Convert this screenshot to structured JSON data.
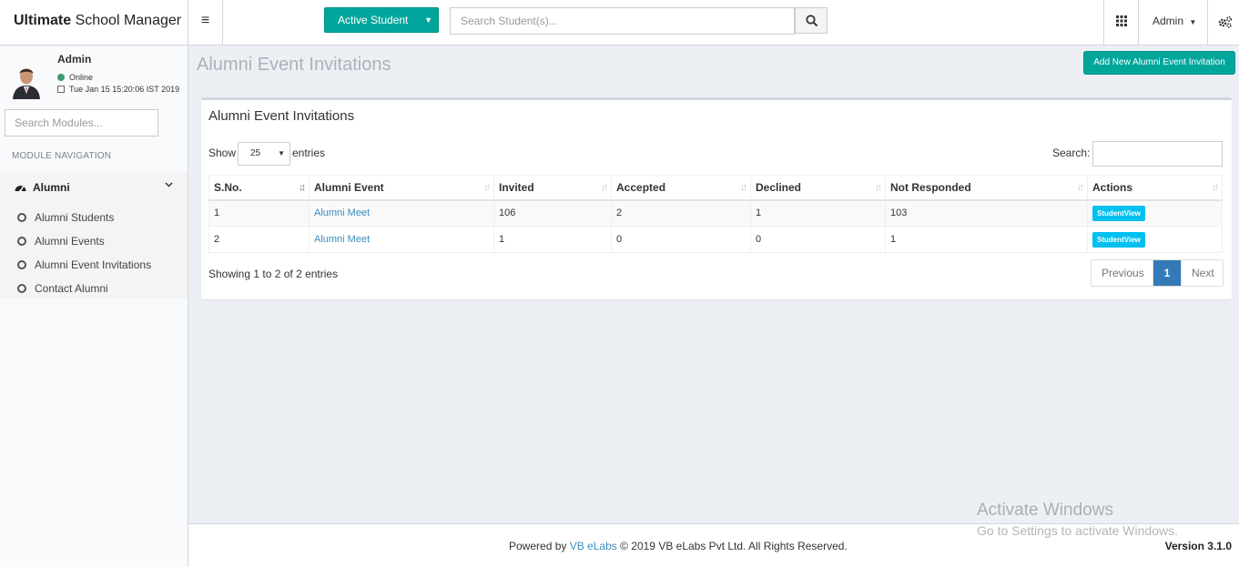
{
  "header": {
    "logo_bold": "Ultimate",
    "logo_rest": " School Manager",
    "active_student_label": "Active Student",
    "search_placeholder": "Search Student(s)...",
    "admin_label": "Admin"
  },
  "sidebar": {
    "user_name": "Admin",
    "status": "Online",
    "datetime": "Tue Jan 15 15:20:06 IST 2019",
    "search_placeholder": "Search Modules...",
    "nav_title": "MODULE NAVIGATION",
    "group_label": "Alumni",
    "items": [
      {
        "label": "Alumni Students"
      },
      {
        "label": "Alumni Events"
      },
      {
        "label": "Alumni Event Invitations"
      },
      {
        "label": "Contact Alumni"
      }
    ]
  },
  "main": {
    "page_title": "Alumni Event Invitations",
    "add_button": "Add New Alumni Event Invitation",
    "box_title": "Alumni Event Invitations",
    "show_label": "Show",
    "entries_value": "25",
    "entries_label": "entries",
    "search_label": "Search:",
    "columns": [
      "S.No.",
      "Alumni Event",
      "Invited",
      "Accepted",
      "Declined",
      "Not Responded",
      "Actions"
    ],
    "rows": [
      {
        "sno": "1",
        "event": "Alumni Meet",
        "invited": "106",
        "accepted": "2",
        "declined": "1",
        "not_responded": "103",
        "action": "StudentView"
      },
      {
        "sno": "2",
        "event": "Alumni Meet",
        "invited": "1",
        "accepted": "0",
        "declined": "0",
        "not_responded": "1",
        "action": "StudentView"
      }
    ],
    "info": "Showing 1 to 2 of 2 entries",
    "pager": {
      "prev": "Previous",
      "current": "1",
      "next": "Next"
    }
  },
  "footer": {
    "powered_by": "Powered by",
    "company_link": "VB eLabs",
    "copyright": "© 2019 VB eLabs Pvt Ltd. All Rights Reserved.",
    "version": "Version 3.1.0"
  },
  "watermark": {
    "line1": "Activate Windows",
    "line2": "Go to Settings to activate Windows."
  },
  "colors": {
    "accent": "#00a69c",
    "link": "#3c8dbc",
    "info_button": "#00c0ef",
    "pager_active": "#337ab7"
  }
}
